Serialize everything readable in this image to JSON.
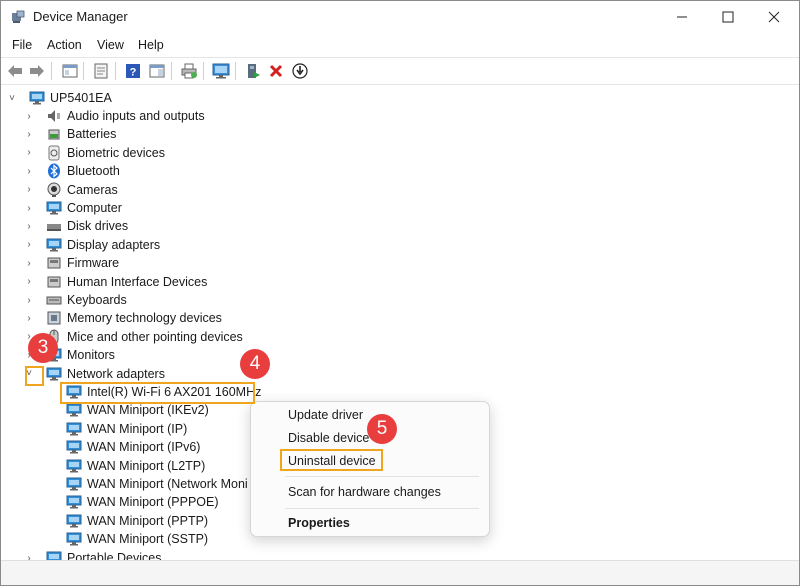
{
  "window": {
    "title": "Device Manager"
  },
  "menu": [
    "File",
    "Action",
    "View",
    "Help"
  ],
  "toolbar_icons": [
    "back-icon",
    "forward-icon",
    "show-hide-tree-icon",
    "properties-icon",
    "help-icon",
    "action-pane-icon",
    "print-icon",
    "monitor-icon",
    "update-driver-icon",
    "uninstall-icon",
    "scan-icon"
  ],
  "tree": {
    "root": "UP5401EA",
    "categories": [
      {
        "label": "Audio inputs and outputs",
        "icon": "speaker-icon"
      },
      {
        "label": "Batteries",
        "icon": "battery-icon"
      },
      {
        "label": "Biometric devices",
        "icon": "fingerprint-icon"
      },
      {
        "label": "Bluetooth",
        "icon": "bluetooth-icon"
      },
      {
        "label": "Cameras",
        "icon": "camera-icon"
      },
      {
        "label": "Computer",
        "icon": "computer-icon"
      },
      {
        "label": "Disk drives",
        "icon": "disk-icon"
      },
      {
        "label": "Display adapters",
        "icon": "display-icon"
      },
      {
        "label": "Firmware",
        "icon": "firmware-icon"
      },
      {
        "label": "Human Interface Devices",
        "icon": "hid-icon"
      },
      {
        "label": "Keyboards",
        "icon": "keyboard-icon"
      },
      {
        "label": "Memory technology devices",
        "icon": "memory-icon"
      },
      {
        "label": "Mice and other pointing devices",
        "icon": "mouse-icon"
      },
      {
        "label": "Monitors",
        "icon": "monitor-icon"
      },
      {
        "label": "Network adapters",
        "icon": "network-icon"
      }
    ],
    "network_children": [
      "Intel(R) Wi-Fi 6 AX201 160MHz",
      "WAN Miniport (IKEv2)",
      "WAN Miniport (IP)",
      "WAN Miniport (IPv6)",
      "WAN Miniport (L2TP)",
      "WAN Miniport (Network Moni",
      "WAN Miniport (PPPOE)",
      "WAN Miniport (PPTP)",
      "WAN Miniport (SSTP)"
    ],
    "after": "Portable Devices"
  },
  "context_menu": {
    "update": "Update driver",
    "disable": "Disable device",
    "uninstall": "Uninstall device",
    "scan": "Scan for hardware changes",
    "properties": "Properties"
  },
  "steps": [
    "3",
    "4",
    "5"
  ],
  "colors": {
    "highlight": "#f0a51e",
    "step_badge": "#e83e3e",
    "net_icon": "#2f8fd8"
  }
}
